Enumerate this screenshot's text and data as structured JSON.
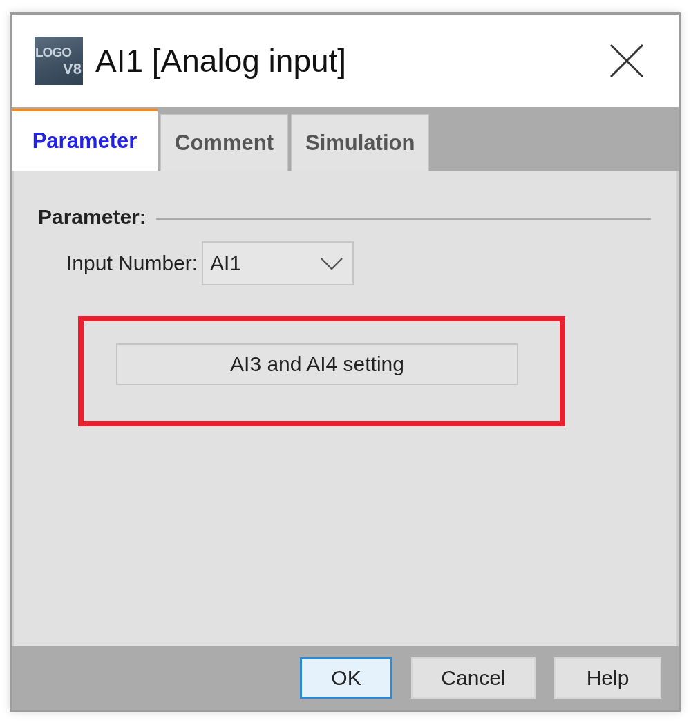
{
  "window": {
    "title": "AI1 [Analog input]",
    "logo": [
      "LOGO",
      "V8"
    ]
  },
  "tabs": [
    {
      "label": "Parameter",
      "selected": true
    },
    {
      "label": "Comment",
      "selected": false
    },
    {
      "label": "Simulation",
      "selected": false
    }
  ],
  "parameter_group": {
    "title": "Parameter:",
    "input_number": {
      "label": "Input Number:",
      "value": "AI1"
    },
    "setting_button": {
      "label": "AI3 and AI4 setting",
      "highlighted": true
    }
  },
  "buttons": [
    {
      "label": "OK",
      "default": true
    },
    {
      "label": "Cancel",
      "default": false
    },
    {
      "label": "Help",
      "default": false
    }
  ]
}
